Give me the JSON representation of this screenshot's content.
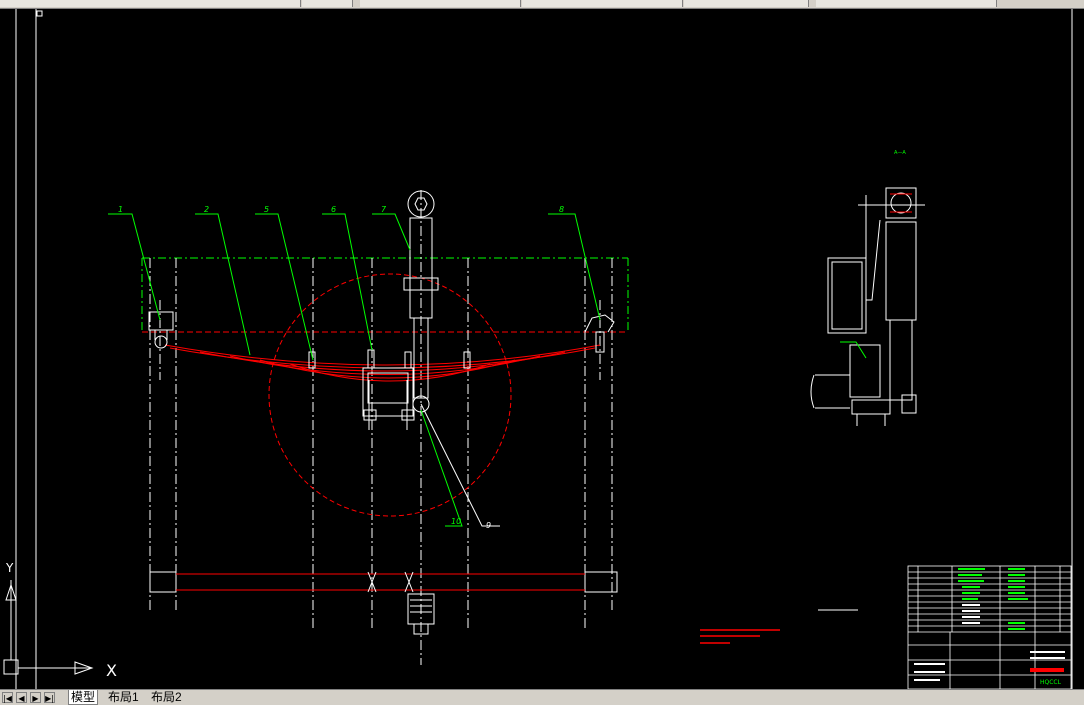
{
  "title_block": {
    "drawing_code": "HQCCL"
  },
  "tabs": [
    {
      "label": "模型"
    },
    {
      "label": "布局1"
    },
    {
      "label": "布局2"
    }
  ],
  "ucs": {
    "x_label": "X",
    "y_label": "Y"
  },
  "balloons": [
    "1",
    "2",
    "5",
    "6",
    "7",
    "8",
    "10",
    "9"
  ],
  "section_label": "A—A",
  "colors": {
    "background": "#000000",
    "line_white": "#ffffff",
    "line_red": "#ff0000",
    "line_green": "#00ff00",
    "ui_gray": "#d4d0c8"
  },
  "icons": [
    "nav-first-icon",
    "nav-prev-icon",
    "nav-next-icon",
    "nav-last-icon",
    "ucs-icon"
  ]
}
